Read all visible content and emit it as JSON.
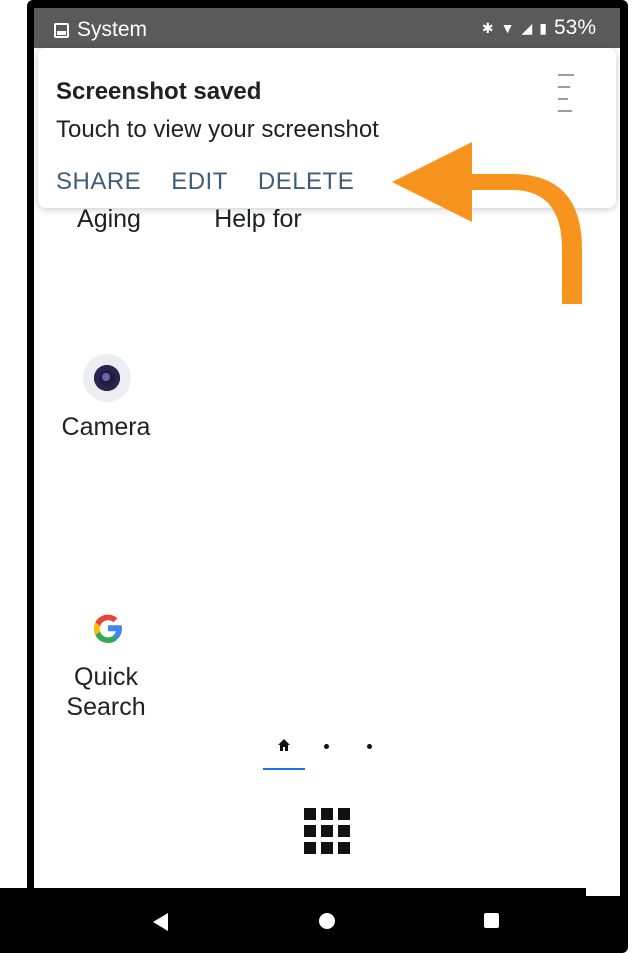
{
  "status_bar": {
    "app_name": "System",
    "battery": "53%",
    "icons": [
      "image-icon",
      "bluetooth-icon",
      "wifi-icon",
      "signal-icon",
      "battery-icon"
    ]
  },
  "notification": {
    "title": "Screenshot saved",
    "text": "Touch to view your screenshot",
    "actions": [
      "SHARE",
      "EDIT",
      "DELETE"
    ]
  },
  "annotation": {
    "arrow_color": "#f7941d"
  },
  "home_apps": [
    {
      "label": "Aging",
      "icon": "app-icon"
    },
    {
      "label": "Help for",
      "icon": "app-icon"
    },
    {
      "label": "Camera",
      "icon": "camera-icon"
    },
    {
      "label": "Quick\nSearch",
      "icon": "google-icon"
    }
  ],
  "navigation": {
    "page_indicators": [
      "home-icon",
      "dot",
      "dot"
    ],
    "app_drawer_icon": "apps-grid-icon",
    "system_buttons": [
      "back-icon",
      "home-icon",
      "recent-apps-icon"
    ]
  }
}
